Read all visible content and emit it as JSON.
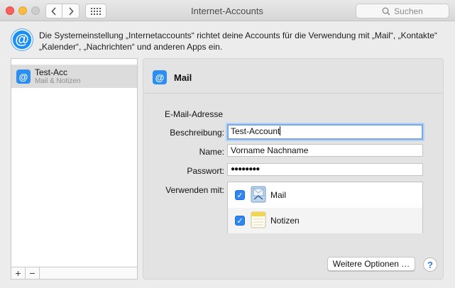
{
  "window": {
    "title": "Internet-Accounts",
    "search_placeholder": "Suchen"
  },
  "info": {
    "icon": "@",
    "text": "Die Systemeinstellung „Internetaccounts“ richtet deine Accounts für die Verwendung mit „Mail“, „Kontakte“ „Kalender“, „Nachrichten“ und anderen Apps ein."
  },
  "accounts": {
    "items": [
      {
        "icon": "@",
        "name": "Test-Acc",
        "subtitle": "Mail & Notizen",
        "selected": true
      }
    ],
    "add_label": "+",
    "remove_label": "−"
  },
  "detail": {
    "icon": "@",
    "title": "Mail",
    "email_label": "E-Mail-Adresse",
    "description_label": "Beschreibung:",
    "description_value": "Test-Account",
    "name_label": "Name:",
    "name_value": "Vorname Nachname",
    "password_label": "Passwort:",
    "password_value": "●●●●●●●●",
    "use_with_label": "Verwenden mit:",
    "apps": [
      {
        "name": "Mail",
        "checked": true,
        "icon": "mail-app-icon"
      },
      {
        "name": "Notizen",
        "checked": true,
        "icon": "notes-app-icon"
      }
    ],
    "more_options_label": "Weitere Optionen …",
    "help_label": "?"
  },
  "colors": {
    "accent": "#2f86f1",
    "selection": "#dcdcdc"
  }
}
